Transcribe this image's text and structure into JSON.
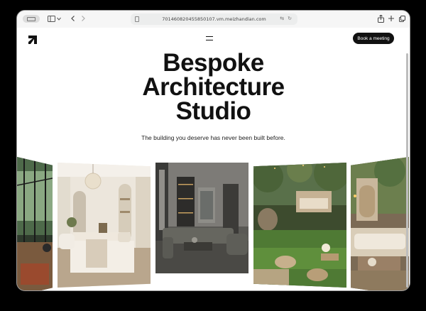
{
  "browser": {
    "url": "701460820455850107.vm.meizhandian.com"
  },
  "header": {
    "cta_label": "Book a meeting"
  },
  "hero": {
    "title_line1": "Bespoke",
    "title_line2": "Architecture",
    "title_line3": "Studio",
    "subtitle": "The building you deserve has never been built before."
  },
  "icons": [
    "sidebar-icon",
    "chevron-down-icon",
    "back-icon",
    "forward-icon",
    "share-icon",
    "new-tab-icon",
    "tabs-icon",
    "menu-icon",
    "logo-icon"
  ],
  "gallery": {
    "images": [
      "glass-conservatory",
      "bedroom",
      "living-room",
      "garden-terrace",
      "patio-lounge"
    ]
  }
}
